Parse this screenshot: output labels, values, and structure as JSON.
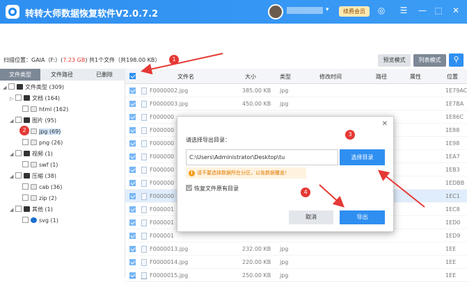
{
  "app": {
    "title": "转转大师数据恢复软件V2.0.7.2",
    "vip_label": "续费会员"
  },
  "toolbar": {
    "scan_prefix": "扫描位置：GAIA（F:）(",
    "scan_size": "7.23 GB",
    "scan_suffix": ")   共1个文件（共198.00 KB）",
    "preview_mode": "预览模式",
    "list_mode": "列表模式"
  },
  "badges": [
    "1",
    "2",
    "3",
    "4"
  ],
  "left_tabs": [
    "文件类型",
    "文件路径",
    "已删除"
  ],
  "tree": [
    {
      "label": "文件类型 (309)",
      "checked": false,
      "selected": false
    },
    {
      "label": "文档 (164)",
      "checked": false,
      "selected": false
    },
    {
      "label": "html (162)",
      "checked": false,
      "selected": false
    },
    {
      "label": "图片 (95)",
      "checked": false,
      "selected": false
    },
    {
      "label": "jpg (69)",
      "checked": true,
      "selected": true
    },
    {
      "label": "png (26)",
      "checked": false,
      "selected": false
    },
    {
      "label": "视频 (1)",
      "checked": false,
      "selected": false
    },
    {
      "label": "swf (1)",
      "checked": false,
      "selected": false
    },
    {
      "label": "压缩 (38)",
      "checked": false,
      "selected": false
    },
    {
      "label": "cab (36)",
      "checked": false,
      "selected": false
    },
    {
      "label": "zip (2)",
      "checked": false,
      "selected": false
    },
    {
      "label": "其他 (1)",
      "checked": false,
      "selected": false
    },
    {
      "label": "svg (1)",
      "checked": false,
      "selected": false
    }
  ],
  "table": {
    "headers": [
      "文件名",
      "大小",
      "类型",
      "修改时间",
      "路径",
      "属性",
      "位置"
    ],
    "rows": [
      {
        "name": "F0000002.jpg",
        "size": "385.00 KB",
        "type": "jpg",
        "pos": "1E79AC"
      },
      {
        "name": "F0000003.jpg",
        "size": "450.00 KB",
        "type": "jpg",
        "pos": "1E7BA"
      },
      {
        "name": "F000000",
        "size": "",
        "type": "",
        "pos": "1E86C"
      },
      {
        "name": "F000000",
        "size": "",
        "type": "",
        "pos": "1E88"
      },
      {
        "name": "F000000",
        "size": "",
        "type": "",
        "pos": "1E98"
      },
      {
        "name": "F000000",
        "size": "",
        "type": "",
        "pos": "1EA7"
      },
      {
        "name": "F000000",
        "size": "",
        "type": "",
        "pos": "1EB3"
      },
      {
        "name": "F000000",
        "size": "",
        "type": "",
        "pos": "1EDBB"
      },
      {
        "name": "F000000",
        "size": "",
        "type": "",
        "pos": "1EC1",
        "hl": true
      },
      {
        "name": "F000001",
        "size": "",
        "type": "",
        "pos": "1EC8"
      },
      {
        "name": "F000001",
        "size": "",
        "type": "",
        "pos": "1ED0"
      },
      {
        "name": "F000001",
        "size": "",
        "type": "",
        "pos": "1ED9"
      },
      {
        "name": "F0000013.jpg",
        "size": "232.00 KB",
        "type": "jpg",
        "pos": "1EE"
      },
      {
        "name": "F0000014.jpg",
        "size": "220.00 KB",
        "type": "jpg",
        "pos": "1EE"
      },
      {
        "name": "F0000015.jpg",
        "size": "250.00 KB",
        "type": "jpg",
        "pos": "1EE"
      }
    ]
  },
  "dialog": {
    "label": "请选择导出目录：",
    "path": "C:\\Users\\Administrator\\Desktop\\tu",
    "choose_label": "选择目录",
    "warning": "请不要选择数据所在分区，以免数据覆盖！",
    "warn_icon": "!",
    "keep_label": "恢复文件原有目录",
    "cancel_label": "取消",
    "export_label": "导出"
  },
  "colors": {
    "accent": "#2f8ff1",
    "badge": "#e53935",
    "highlight": "#cfe4fa"
  }
}
